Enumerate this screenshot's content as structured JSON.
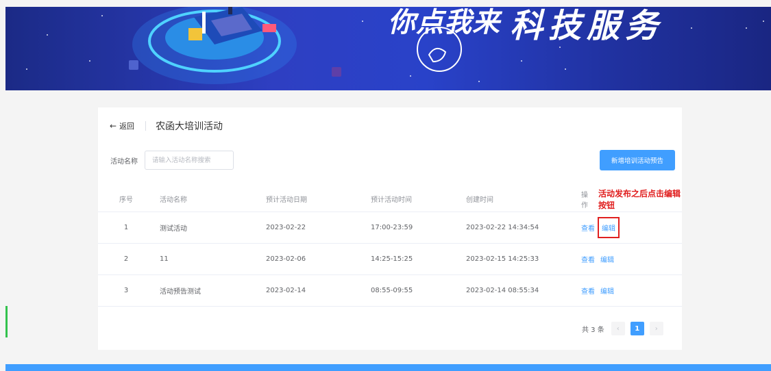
{
  "banner": {
    "logo_text": "你点我来",
    "title": "科技服务"
  },
  "header": {
    "back_label": "返回",
    "back_arrow": "←",
    "page_title": "农函大培训活动"
  },
  "search": {
    "label": "活动名称",
    "placeholder": "请输入活动名称搜索",
    "value": ""
  },
  "add_button_label": "新增培训活动预告",
  "table": {
    "columns": [
      "序号",
      "活动名称",
      "预计活动日期",
      "预计活动时间",
      "创建时间",
      "操作"
    ],
    "annotation": "活动发布之后点击编辑按钮",
    "rows": [
      {
        "index": "1",
        "name": "测试活动",
        "date": "2023-02-22",
        "time": "17:00-23:59",
        "created": "2023-02-22 14:34:54",
        "view": "查看",
        "edit": "编辑"
      },
      {
        "index": "2",
        "name": "11",
        "date": "2023-02-06",
        "time": "14:25-15:25",
        "created": "2023-02-15 14:25:33",
        "view": "查看",
        "edit": "编辑"
      },
      {
        "index": "3",
        "name": "活动预告测试",
        "date": "2023-02-14",
        "time": "08:55-09:55",
        "created": "2023-02-14 08:55:34",
        "view": "查看",
        "edit": "编辑"
      }
    ]
  },
  "pagination": {
    "total": "共 3 条",
    "prev": "‹",
    "current": "1",
    "next": "›"
  },
  "colors": {
    "primary": "#409eff",
    "annotation": "#e01d1d",
    "banner": "#2e3fc2"
  }
}
